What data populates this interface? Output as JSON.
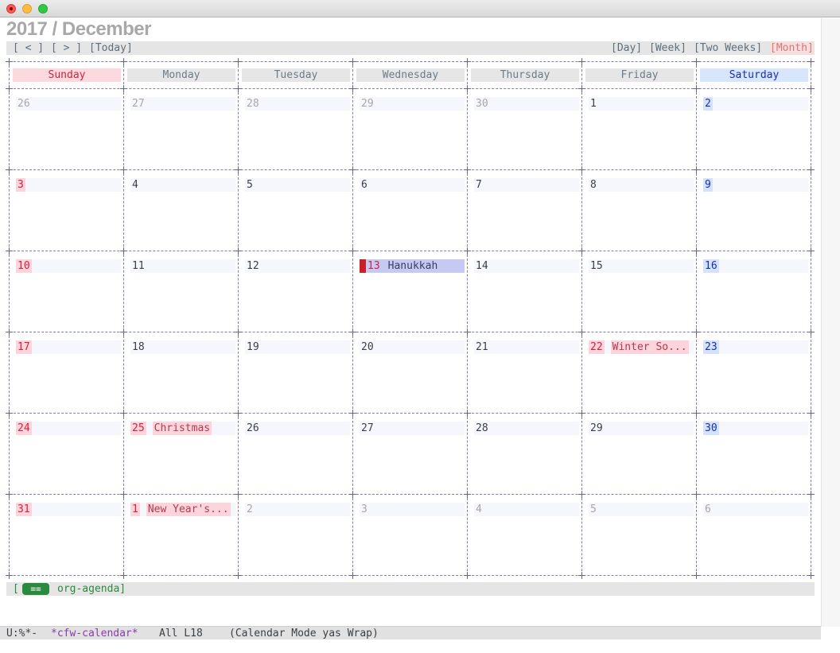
{
  "window": {
    "title": ""
  },
  "calendar_title": "2017 / December",
  "nav": {
    "prev": "[ < ]",
    "next": "[ > ]",
    "today": "[Today]",
    "views": [
      "[Day]",
      "[Week]",
      "[Two Weeks]",
      "[Month]"
    ],
    "active_view": "[Month]"
  },
  "weekdays": [
    "Sunday",
    "Monday",
    "Tuesday",
    "Wednesday",
    "Thursday",
    "Friday",
    "Saturday"
  ],
  "weeks": [
    [
      {
        "day": "26",
        "type": "other"
      },
      {
        "day": "27",
        "type": "other"
      },
      {
        "day": "28",
        "type": "other"
      },
      {
        "day": "29",
        "type": "other"
      },
      {
        "day": "30",
        "type": "other"
      },
      {
        "day": "1",
        "type": "cur"
      },
      {
        "day": "2",
        "type": "sat"
      }
    ],
    [
      {
        "day": "3",
        "type": "sun"
      },
      {
        "day": "4",
        "type": "cur"
      },
      {
        "day": "5",
        "type": "cur"
      },
      {
        "day": "6",
        "type": "cur"
      },
      {
        "day": "7",
        "type": "cur"
      },
      {
        "day": "8",
        "type": "cur"
      },
      {
        "day": "9",
        "type": "sat"
      }
    ],
    [
      {
        "day": "10",
        "type": "sun"
      },
      {
        "day": "11",
        "type": "cur"
      },
      {
        "day": "12",
        "type": "cur"
      },
      {
        "day": "13",
        "type": "today",
        "event": "Hanukkah"
      },
      {
        "day": "14",
        "type": "cur"
      },
      {
        "day": "15",
        "type": "cur"
      },
      {
        "day": "16",
        "type": "sat"
      }
    ],
    [
      {
        "day": "17",
        "type": "sun"
      },
      {
        "day": "18",
        "type": "cur"
      },
      {
        "day": "19",
        "type": "cur"
      },
      {
        "day": "20",
        "type": "cur"
      },
      {
        "day": "21",
        "type": "cur"
      },
      {
        "day": "22",
        "type": "hol",
        "event": "Winter So..."
      },
      {
        "day": "23",
        "type": "sat"
      }
    ],
    [
      {
        "day": "24",
        "type": "sun"
      },
      {
        "day": "25",
        "type": "hol",
        "event": "Christmas"
      },
      {
        "day": "26",
        "type": "cur"
      },
      {
        "day": "27",
        "type": "cur"
      },
      {
        "day": "28",
        "type": "cur"
      },
      {
        "day": "29",
        "type": "cur"
      },
      {
        "day": "30",
        "type": "sat"
      }
    ],
    [
      {
        "day": "31",
        "type": "sun"
      },
      {
        "day": "1",
        "type": "hol",
        "event": "New Year's..."
      },
      {
        "day": "2",
        "type": "other"
      },
      {
        "day": "3",
        "type": "other"
      },
      {
        "day": "4",
        "type": "other"
      },
      {
        "day": "5",
        "type": "other"
      },
      {
        "day": "6",
        "type": "other"
      }
    ]
  ],
  "agenda": {
    "bracket_open": "[",
    "badge": "==",
    "label": "org-agenda]"
  },
  "modeline": {
    "status": "U:%*-",
    "buffer": "*cfw-calendar*",
    "position": "All L18",
    "modes": "(Calendar Mode yas Wrap)"
  },
  "colors": {
    "grid": "#7b7bd6",
    "sunday": "#d1223f",
    "saturday": "#1a2fb0",
    "today": "#c8202a",
    "agenda": "#2a8a3d"
  }
}
